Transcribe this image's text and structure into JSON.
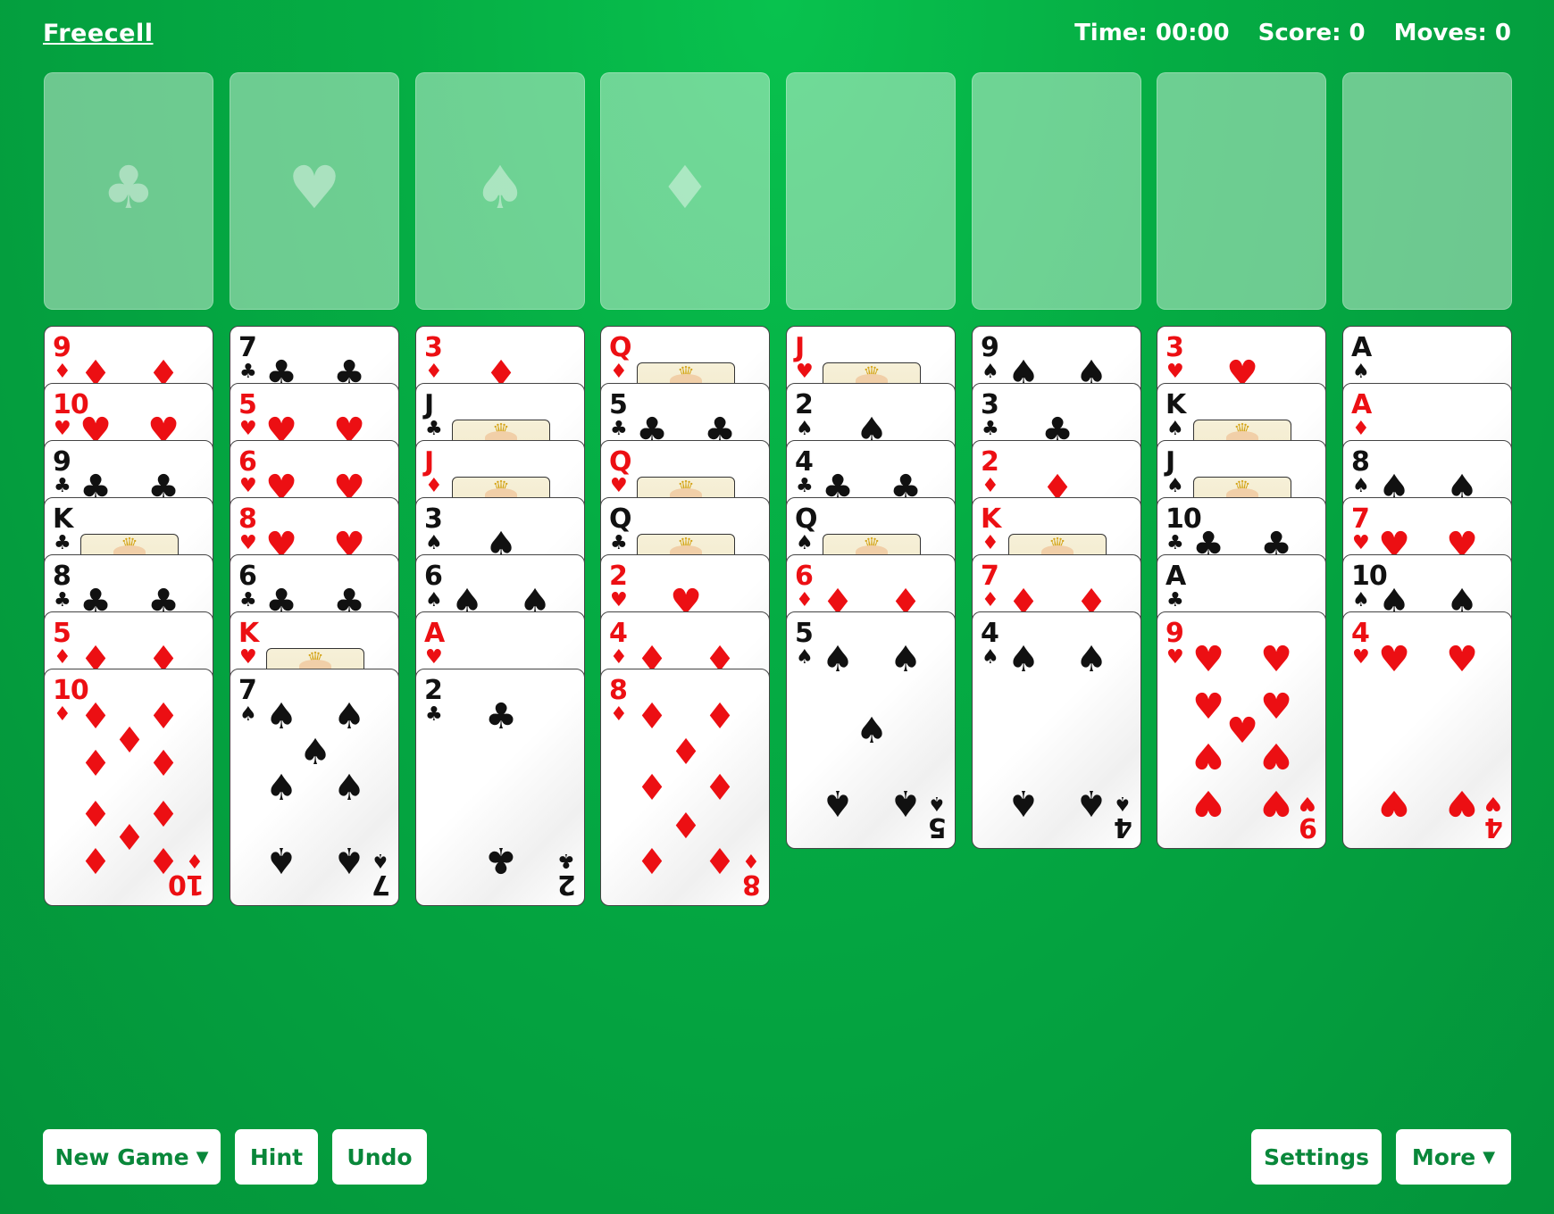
{
  "header": {
    "title": "Freecell",
    "time_label": "Time: 00:00",
    "score_label": "Score: 0",
    "moves_label": "Moves: 0"
  },
  "foundations": [
    {
      "suit_icon": "♣"
    },
    {
      "suit_icon": "♥"
    },
    {
      "suit_icon": "♠"
    },
    {
      "suit_icon": "♦"
    }
  ],
  "free_cells": [
    {},
    {},
    {},
    {}
  ],
  "tableau": [
    [
      {
        "rank": "9",
        "suit": "♦"
      },
      {
        "rank": "10",
        "suit": "♥"
      },
      {
        "rank": "9",
        "suit": "♣"
      },
      {
        "rank": "K",
        "suit": "♣"
      },
      {
        "rank": "8",
        "suit": "♣"
      },
      {
        "rank": "5",
        "suit": "♦"
      },
      {
        "rank": "10",
        "suit": "♦"
      }
    ],
    [
      {
        "rank": "7",
        "suit": "♣"
      },
      {
        "rank": "5",
        "suit": "♥"
      },
      {
        "rank": "6",
        "suit": "♥"
      },
      {
        "rank": "8",
        "suit": "♥"
      },
      {
        "rank": "6",
        "suit": "♣"
      },
      {
        "rank": "K",
        "suit": "♥"
      },
      {
        "rank": "7",
        "suit": "♠"
      }
    ],
    [
      {
        "rank": "3",
        "suit": "♦"
      },
      {
        "rank": "J",
        "suit": "♣"
      },
      {
        "rank": "J",
        "suit": "♦"
      },
      {
        "rank": "3",
        "suit": "♠"
      },
      {
        "rank": "6",
        "suit": "♠"
      },
      {
        "rank": "A",
        "suit": "♥"
      },
      {
        "rank": "2",
        "suit": "♣"
      }
    ],
    [
      {
        "rank": "Q",
        "suit": "♦"
      },
      {
        "rank": "5",
        "suit": "♣"
      },
      {
        "rank": "Q",
        "suit": "♥"
      },
      {
        "rank": "Q",
        "suit": "♣"
      },
      {
        "rank": "2",
        "suit": "♥"
      },
      {
        "rank": "4",
        "suit": "♦"
      },
      {
        "rank": "8",
        "suit": "♦"
      }
    ],
    [
      {
        "rank": "J",
        "suit": "♥"
      },
      {
        "rank": "2",
        "suit": "♠"
      },
      {
        "rank": "4",
        "suit": "♣"
      },
      {
        "rank": "Q",
        "suit": "♠"
      },
      {
        "rank": "6",
        "suit": "♦"
      },
      {
        "rank": "5",
        "suit": "♠"
      }
    ],
    [
      {
        "rank": "9",
        "suit": "♠"
      },
      {
        "rank": "3",
        "suit": "♣"
      },
      {
        "rank": "2",
        "suit": "♦"
      },
      {
        "rank": "K",
        "suit": "♦"
      },
      {
        "rank": "7",
        "suit": "♦"
      },
      {
        "rank": "4",
        "suit": "♠"
      }
    ],
    [
      {
        "rank": "3",
        "suit": "♥"
      },
      {
        "rank": "K",
        "suit": "♠"
      },
      {
        "rank": "J",
        "suit": "♠"
      },
      {
        "rank": "10",
        "suit": "♣"
      },
      {
        "rank": "A",
        "suit": "♣"
      },
      {
        "rank": "9",
        "suit": "♥"
      }
    ],
    [
      {
        "rank": "A",
        "suit": "♠"
      },
      {
        "rank": "A",
        "suit": "♦"
      },
      {
        "rank": "8",
        "suit": "♠"
      },
      {
        "rank": "7",
        "suit": "♥"
      },
      {
        "rank": "10",
        "suit": "♠"
      },
      {
        "rank": "4",
        "suit": "♥"
      }
    ]
  ],
  "colors": {
    "red_suit": "#ec0f13",
    "black_suit": "#111111",
    "table_green": "#05ad44",
    "button_text": "#09873a"
  },
  "buttons": {
    "new_game": "New Game",
    "hint": "Hint",
    "undo": "Undo",
    "settings": "Settings",
    "more": "More",
    "dropdown_caret": "▼"
  }
}
